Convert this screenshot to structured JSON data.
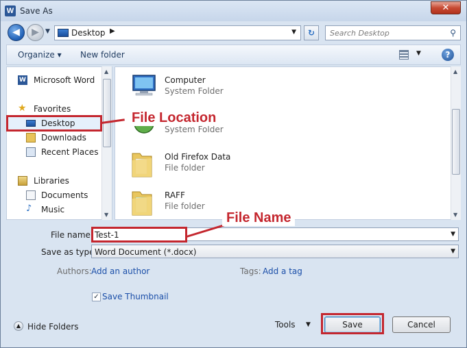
{
  "window": {
    "title": "Save As",
    "app_icon_letter": "W",
    "close_glyph": "✕"
  },
  "nav": {
    "back_glyph": "◀",
    "forward_glyph": "▶",
    "history_glyph": "▼",
    "address": "Desktop",
    "address_sep": "▶",
    "address_drop": "▼",
    "refresh_glyph": "↻",
    "search_placeholder": "Search Desktop",
    "search_glyph": "⚲"
  },
  "toolbar": {
    "organize": "Organize ▾",
    "new_folder": "New folder",
    "view_drop": "▼",
    "help": "?"
  },
  "sidebar": {
    "items": [
      {
        "label": "Microsoft Word",
        "icon": "word-icon"
      },
      {
        "label": "Favorites",
        "icon": "star-icon"
      },
      {
        "label": "Desktop",
        "icon": "desktop-icon"
      },
      {
        "label": "Downloads",
        "icon": "downloads-icon"
      },
      {
        "label": "Recent Places",
        "icon": "recent-places-icon"
      },
      {
        "label": "Libraries",
        "icon": "libraries-icon"
      },
      {
        "label": "Documents",
        "icon": "documents-icon"
      },
      {
        "label": "Music",
        "icon": "music-icon"
      }
    ]
  },
  "files": [
    {
      "name": "Computer",
      "type": "System Folder",
      "icon": "computer-icon"
    },
    {
      "name": "",
      "type": "System Folder",
      "icon": "network-icon"
    },
    {
      "name": "Old Firefox Data",
      "type": "File folder",
      "icon": "folder-icon"
    },
    {
      "name": "RAFF",
      "type": "File folder",
      "icon": "folder-icon"
    }
  ],
  "form": {
    "file_name_label": "File name:",
    "file_name_value": "Test-1",
    "save_type_label": "Save as type:",
    "save_type_value": "Word Document (*.docx)",
    "authors_label": "Authors:",
    "authors_link": "Add an author",
    "tags_label": "Tags:",
    "tags_link": "Add a tag",
    "save_thumbnail_label": "Save Thumbnail",
    "save_thumbnail_checked": "✓",
    "drop_arrow": "▼"
  },
  "footer": {
    "hide_folders": "Hide Folders",
    "hide_folders_glyph": "▲",
    "tools": "Tools",
    "tools_drop": "▼",
    "save": "Save",
    "cancel": "Cancel"
  },
  "annotations": {
    "file_location": "File Location",
    "file_name": "File Name",
    "color": "#c4262e"
  }
}
